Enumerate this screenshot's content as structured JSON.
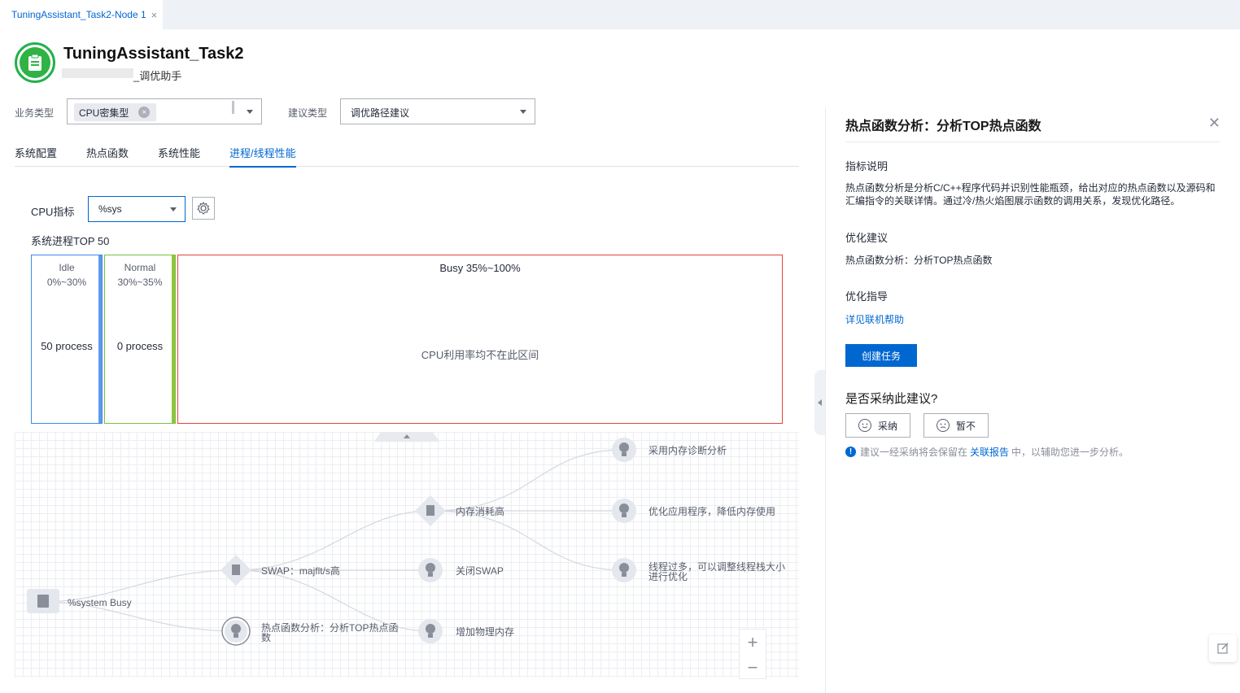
{
  "tab": {
    "label": "TuningAssistant_Task2-Node 1",
    "close": "×"
  },
  "header": {
    "title": "TuningAssistant_Task2",
    "subtitle": "_调优助手"
  },
  "filters": {
    "biz_label": "业务类型",
    "biz_tag": "CPU密集型",
    "biz_tag_close": "×",
    "advice_label": "建议类型",
    "advice_value": "调优路径建议"
  },
  "tabs": [
    {
      "label": "系统配置",
      "active": false
    },
    {
      "label": "热点函数",
      "active": false
    },
    {
      "label": "系统性能",
      "active": false
    },
    {
      "label": "进程/线程性能",
      "active": true
    }
  ],
  "cpu_metric": {
    "label": "CPU指标",
    "value": "%sys"
  },
  "top50_title": "系统进程TOP 50",
  "buckets": [
    {
      "name": "Idle",
      "range": "0%~30%",
      "count": "50 process",
      "border": "#3b8ae6",
      "bar": "#5b9bea"
    },
    {
      "name": "Normal",
      "range": "30%~35%",
      "count": "0 process",
      "border": "#7ac143",
      "bar": "#8ec63f"
    },
    {
      "name": "Busy 35%~100%",
      "range": "",
      "count": "CPU利用率均不在此区间",
      "border": "#e0443e",
      "bar": ""
    }
  ],
  "graph": {
    "nodes": [
      {
        "id": "root",
        "label": "%system Busy",
        "icon": "cpu-chip-icon"
      },
      {
        "id": "swap",
        "label": "SWAP：majflt/s高",
        "icon": "document-icon"
      },
      {
        "id": "hotspot",
        "label": "热点函数分析：分析TOP热点函数",
        "icon": "lightbulb-icon"
      },
      {
        "id": "mem",
        "label": "内存消耗高",
        "icon": "document-icon"
      },
      {
        "id": "closeswap",
        "label": "关闭SWAP",
        "icon": "lightbulb-icon"
      },
      {
        "id": "addmem",
        "label": "增加物理内存",
        "icon": "lightbulb-icon"
      },
      {
        "id": "memdiag",
        "label": "采用内存诊断分析",
        "icon": "lightbulb-icon"
      },
      {
        "id": "optapp",
        "label": "优化应用程序，降低内存使用",
        "icon": "lightbulb-icon"
      },
      {
        "id": "threads",
        "label": "线程过多，可以调整线程栈大小进行优化",
        "icon": "lightbulb-icon"
      }
    ],
    "zoom_in": "+",
    "zoom_out": "−"
  },
  "panel": {
    "title": "热点函数分析：分析TOP热点函数",
    "close": "✕",
    "desc_heading": "指标说明",
    "desc_text": "热点函数分析是分析C/C++程序代码并识别性能瓶颈，给出对应的热点函数以及源码和汇编指令的关联详情。通过冷/热火焰图展示函数的调用关系，发现优化路径。",
    "advice_heading": "优化建议",
    "advice_text": "热点函数分析：分析TOP热点函数",
    "guide_heading": "优化指导",
    "guide_link": "详见联机帮助",
    "create_button": "创建任务",
    "question": "是否采纳此建议?",
    "accept": "采纳",
    "reject": "暂不",
    "hint_pre": "建议一经采纳将会保留在",
    "hint_link": "关联报告",
    "hint_post": "中，以辅助您进一步分析。"
  },
  "colors": {
    "accent": "#0067d1",
    "success": "#2fb344"
  }
}
